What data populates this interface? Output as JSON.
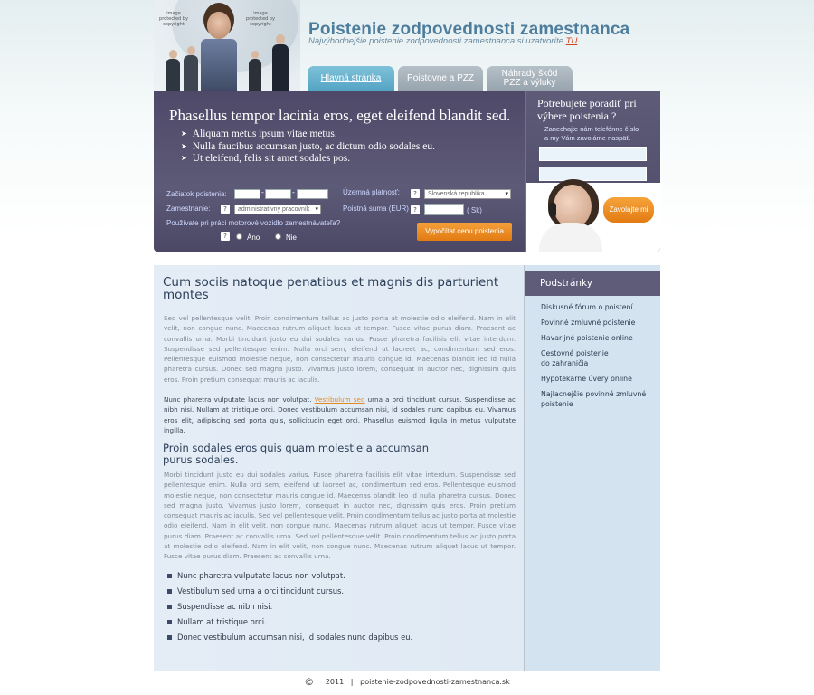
{
  "header": {
    "title": "Poistenie zodpovednosti zamestnanca",
    "tagline": "Najvýhodnejšie poistenie zodpovednosti zamestnanca si uzatvoríte",
    "tagline_link": "TU",
    "image_stamp": "image protected by copyright"
  },
  "tabs": [
    {
      "label": "Hlavná stránka"
    },
    {
      "label": "Poistovne a PZZ"
    },
    {
      "label": "Náhrady škôd PZZ a výluky"
    }
  ],
  "banner": {
    "title": "Phasellus tempor lacinia eros, eget eleifend blandit sed.",
    "items": [
      "Aliquam metus ipsum vitae metus.",
      "Nulla faucibus accumsan justo, ac dictum odio sodales eu.",
      "Ut eleifend, felis sit amet sodales pos."
    ]
  },
  "form": {
    "start_label": "Začiatok poistenia:",
    "employee_label": "Zamestnanie:",
    "employee_value": "administratívny pracovník",
    "motor_question": "Používate pri práci motorové vozidlo zamestnávateľa?",
    "yes_label": "Áno",
    "no_label": "Nie",
    "territory_label": "Územná platnosť:",
    "territory_value": "Slovenská republika",
    "sum_label": "Poistná suma (EUR)",
    "sum_unit": "( Sk)",
    "help": "?",
    "calc_button": "Vypočítat cenu poistenia"
  },
  "callbox": {
    "title_line1": "Potrebujete poradiť pri",
    "title_line2": "výbere poistenia ?",
    "sub_line1": "Zanechajte nám telefónne číslo",
    "sub_line2": "a my Vám zavoláme naspäť.",
    "button": "Zavolajte mi"
  },
  "content": {
    "heading1": "Cum sociis natoque penatibus et magnis dis parturient montes",
    "para1": "Sed vel pellentesque velit. Proin condimentum tellus ac justo porta at molestie odio eleifend. Nam in elit velit, non congue nunc. Maecenas rutrum aliquet lacus ut tempor. Fusce vitae purus diam. Praesent ac convallis urna. Morbi tincidunt justo eu dui sodales varius. Fusce pharetra facilisis elit vitae interdum. Suspendisse sed pellentesque enim. Nulla orci sem, eleifend ut laoreet ac, condimentum sed eros. Pellentesque euismod molestie neque, non consectetur mauris congue id. Maecenas blandit leo id nulla pharetra cursus. Donec sed magna justo. Vivamus justo lorem, consequat in auctor nec, dignissim quis eros. Proin pretium consequat mauris ac iaculis.",
    "para2_before": "Nunc pharetra vulputate lacus non volutpat. ",
    "para2_link": "Vestibulum sed",
    "para2_after": " urna a orci tincidunt cursus. Suspendisse ac nibh nisi. Nullam at tristique orci. Donec vestibulum accumsan nisi, id sodales nunc dapibus eu. Vivamus eros elit, adipiscing sed porta quis, sollicitudin eget orci. Phasellus euismod ligula in metus vulputate ingilla.",
    "heading2": "Proin sodales eros quis quam molestie a accumsan purus sodales.",
    "para3": "Morbi tincidunt justo eu dui sodales varius. Fusce pharetra facilisis elit vitae interdum. Suspendisse sed pellentesque enim. Nulla orci sem, eleifend ut laoreet ac, condimentum sed eros. Pellentesque euismod molestie neque, non consectetur mauris congue id. Maecenas blandit leo id nulla pharetra cursus. Donec sed magna justo. Vivamus justo lorem, consequat in auctor nec, dignissim quis eros. Proin pretium consequat mauris ac iaculis. Sed vel pellentesque velit. Proin condimentum tellus ac justo porta at molestie odio eleifend. Nam in elit velit, non congue nunc. Maecenas rutrum aliquet lacus ut tempor. Fusce vitae purus diam. Praesent ac convallis urna. Sed vel pellentesque velit. Proin condimentum tellus ac justo porta at molestie odio eleifend. Nam in elit velit, non congue nunc. Maecenas rutrum aliquet lacus ut tempor. Fusce vitae purus diam. Praesent ac convallis urna.",
    "bullets": [
      "Nunc pharetra vulputate lacus non volutpat.",
      "Vestibulum sed urna a orci tincidunt cursus.",
      "Suspendisse ac nibh nisi.",
      "Nullam at tristique orci.",
      "Donec vestibulum accumsan nisi, id sodales nunc dapibus eu."
    ]
  },
  "sidebar": {
    "title": "Podstránky",
    "links": [
      "Diskusné fórum o poistení.",
      "Povinné zmluvné poistenie",
      "Havarijné poistenie online",
      "Cestovné poistenie do zahraničia",
      "Hypotekárne úvery online",
      "Najlacnejšie povinné zmluvné poistenie"
    ]
  },
  "footer": {
    "copyright_symbol": "©",
    "text": "2011   |   poistenie-zodpovednosti-zamestnanca.sk"
  },
  "colors": {
    "accent_orange": "#e27b12",
    "banner_purple": "#5d5a77",
    "tab_blue": "#53a3c4"
  }
}
